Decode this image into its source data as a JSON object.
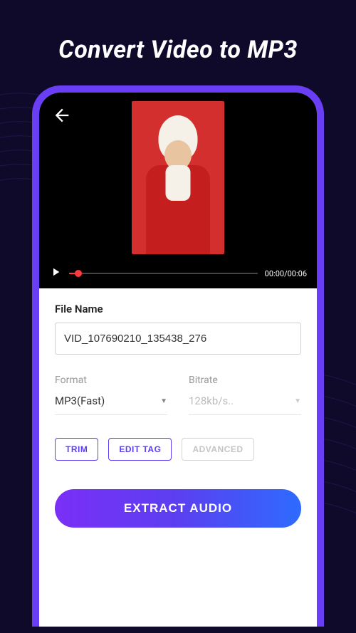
{
  "page_title": "Convert Video to MP3",
  "video": {
    "current_time": "00:00",
    "duration": "00:06",
    "time_display": "00:00/00:06"
  },
  "form": {
    "file_name_label": "File Name",
    "file_name_value": "VID_107690210_135438_276",
    "format_label": "Format",
    "format_value": "MP3(Fast)",
    "bitrate_label": "Bitrate",
    "bitrate_value": "128kb/s.."
  },
  "actions": {
    "trim": "TRIM",
    "edit_tag": "EDIT TAG",
    "advanced": "ADVANCED",
    "extract": "EXTRACT AUDIO"
  }
}
